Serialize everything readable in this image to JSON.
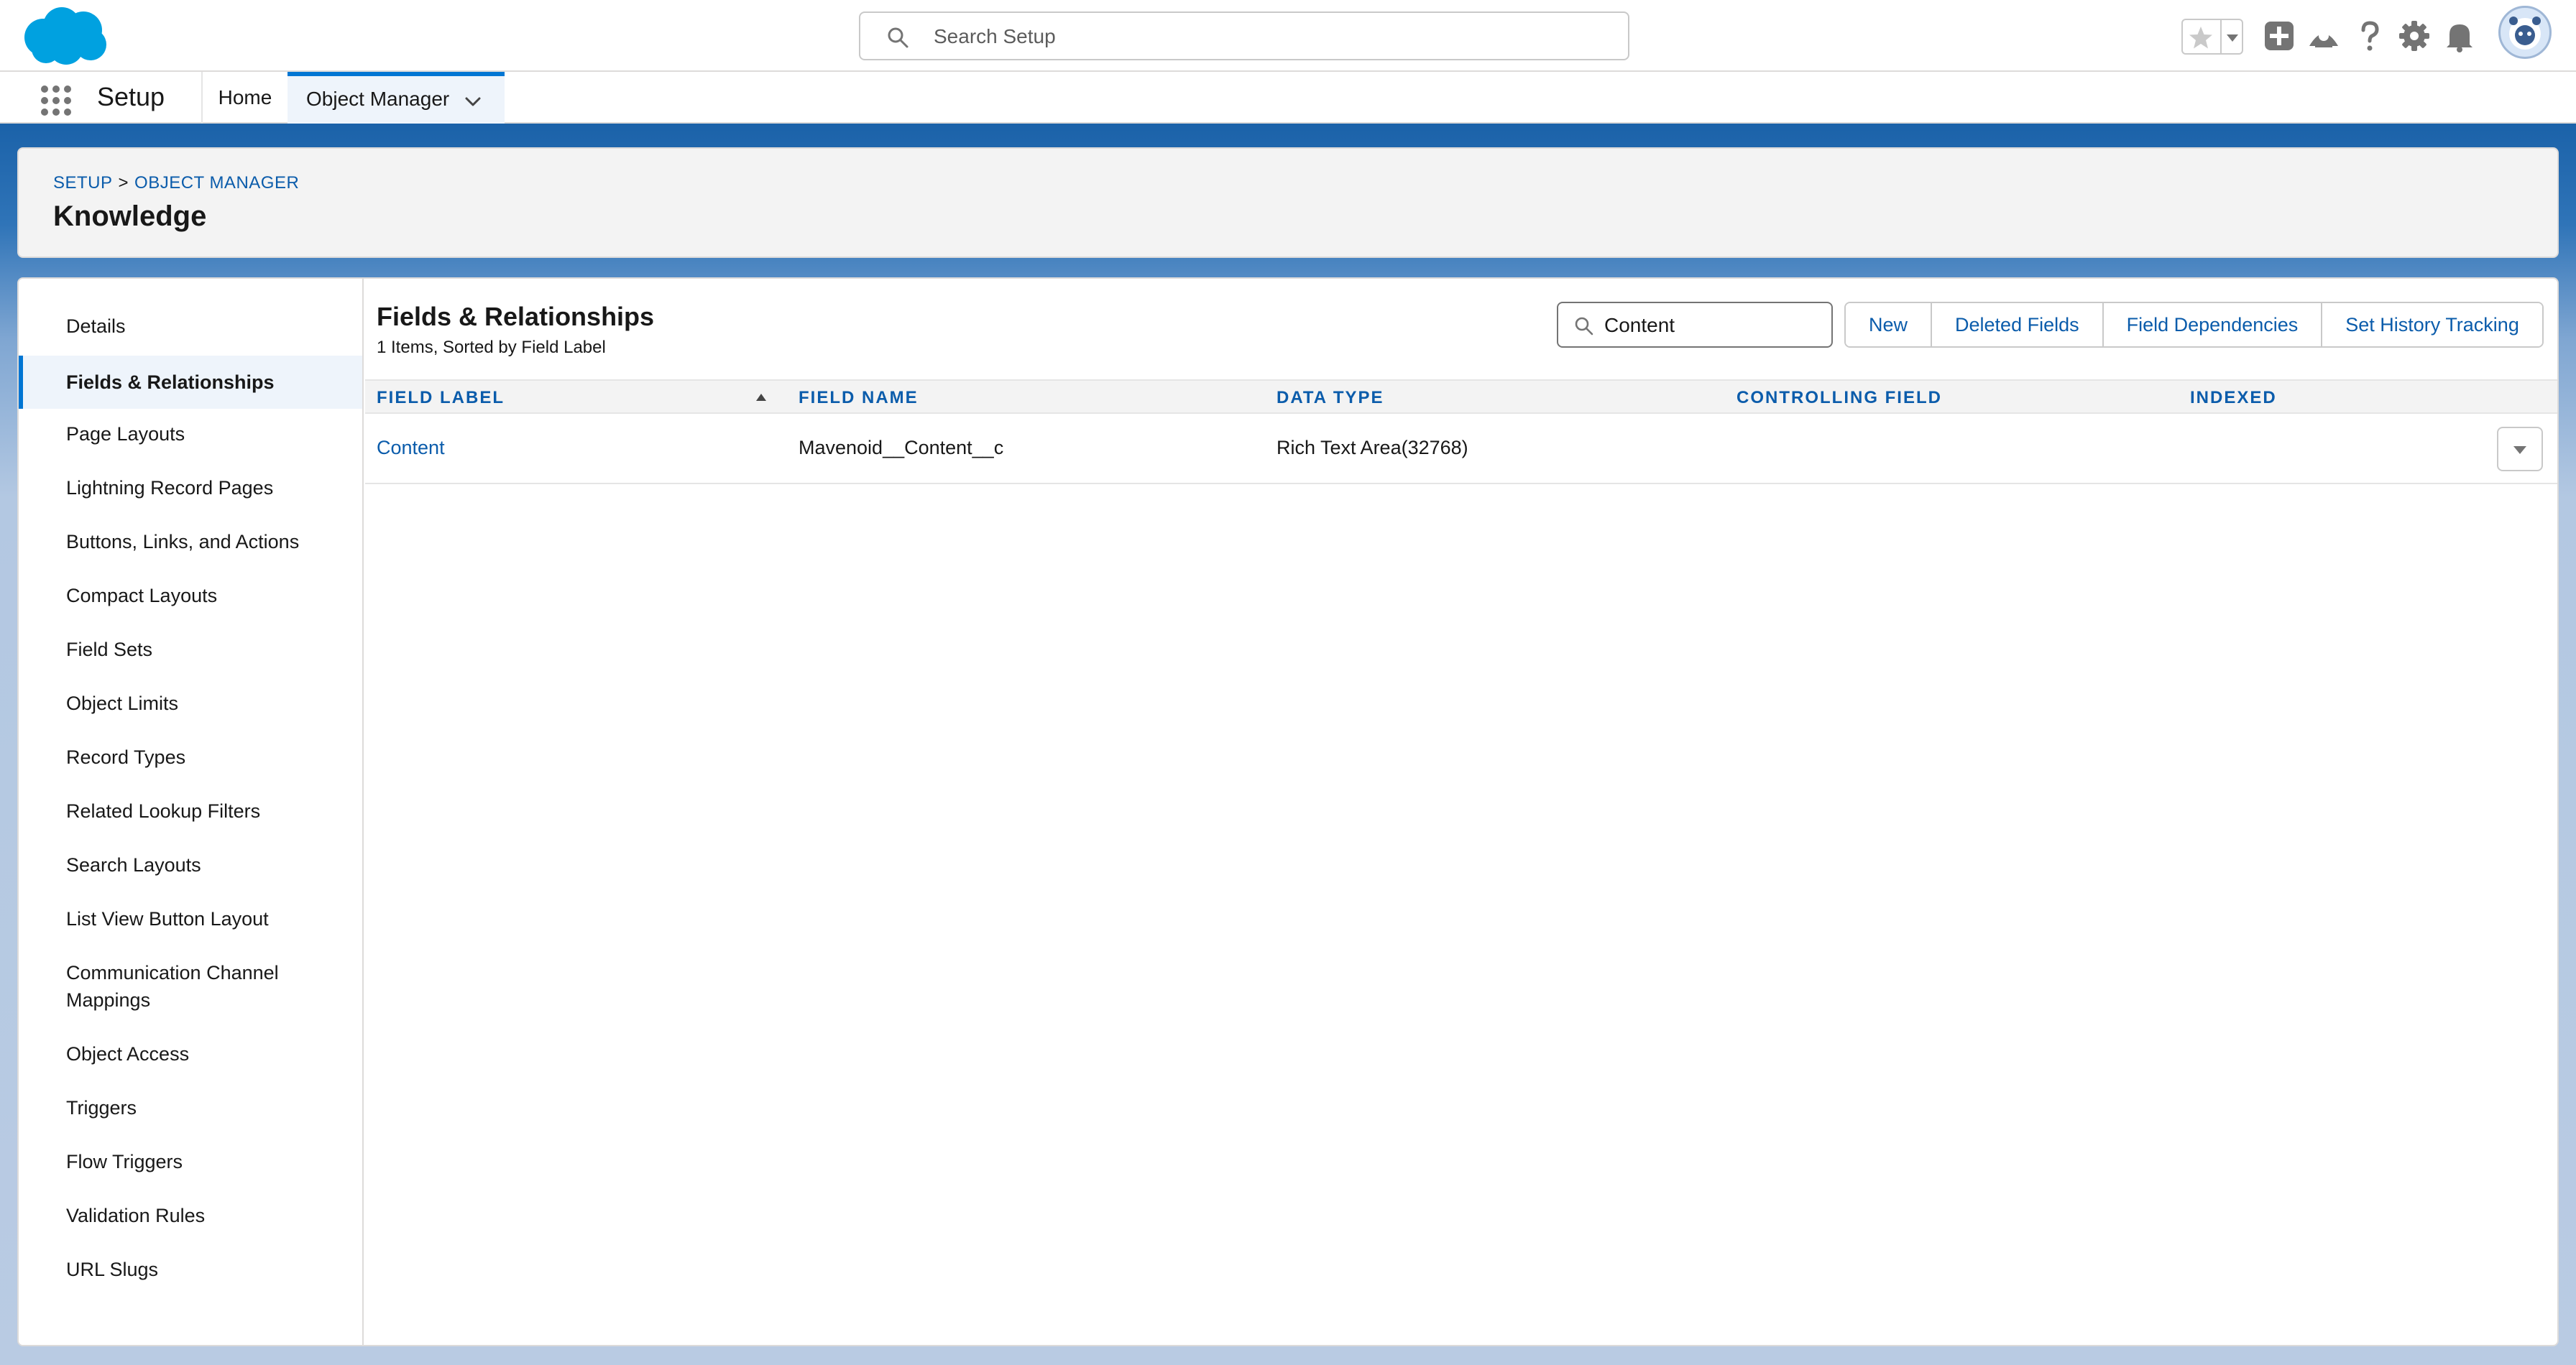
{
  "global_header": {
    "search_placeholder": "Search Setup"
  },
  "nav": {
    "app_name": "Setup",
    "tabs": [
      {
        "label": "Home"
      },
      {
        "label": "Object Manager",
        "active": true
      }
    ]
  },
  "page_header": {
    "breadcrumb": [
      "SETUP",
      "OBJECT MANAGER"
    ],
    "breadcrumb_separator": ">",
    "title": "Knowledge"
  },
  "sidebar": {
    "items": [
      {
        "label": "Details"
      },
      {
        "label": "Fields & Relationships",
        "active": true
      },
      {
        "label": "Page Layouts"
      },
      {
        "label": "Lightning Record Pages"
      },
      {
        "label": "Buttons, Links, and Actions"
      },
      {
        "label": "Compact Layouts"
      },
      {
        "label": "Field Sets"
      },
      {
        "label": "Object Limits"
      },
      {
        "label": "Record Types"
      },
      {
        "label": "Related Lookup Filters"
      },
      {
        "label": "Search Layouts"
      },
      {
        "label": "List View Button Layout"
      },
      {
        "label": "Communication Channel Mappings"
      },
      {
        "label": "Object Access"
      },
      {
        "label": "Triggers"
      },
      {
        "label": "Flow Triggers"
      },
      {
        "label": "Validation Rules"
      },
      {
        "label": "URL Slugs"
      }
    ]
  },
  "content": {
    "title": "Fields & Relationships",
    "subtitle": "1 Items, Sorted by Field Label",
    "quick_find_value": "Content",
    "buttons": {
      "new": "New",
      "deleted_fields": "Deleted Fields",
      "field_dependencies": "Field Dependencies",
      "set_history_tracking": "Set History Tracking"
    },
    "table": {
      "columns": [
        "FIELD LABEL",
        "FIELD NAME",
        "DATA TYPE",
        "CONTROLLING FIELD",
        "INDEXED"
      ],
      "sorted_column": "FIELD LABEL",
      "sort_direction": "ascending",
      "rows": [
        {
          "field_label": "Content",
          "field_name": "Mavenoid__Content__c",
          "data_type": "Rich Text Area(32768)",
          "controlling_field": "",
          "indexed": ""
        }
      ]
    }
  },
  "colors": {
    "brand_blue": "#0176d3",
    "link_blue": "#0b5cab",
    "header_band": "#1b62a9"
  },
  "icons": [
    "salesforce-cloud-icon",
    "search-icon",
    "star-icon",
    "chevron-down-icon",
    "plus-icon",
    "trailhead-icon",
    "help-icon",
    "gear-icon",
    "bell-icon",
    "app-launcher-icon",
    "sort-ascending-icon"
  ]
}
